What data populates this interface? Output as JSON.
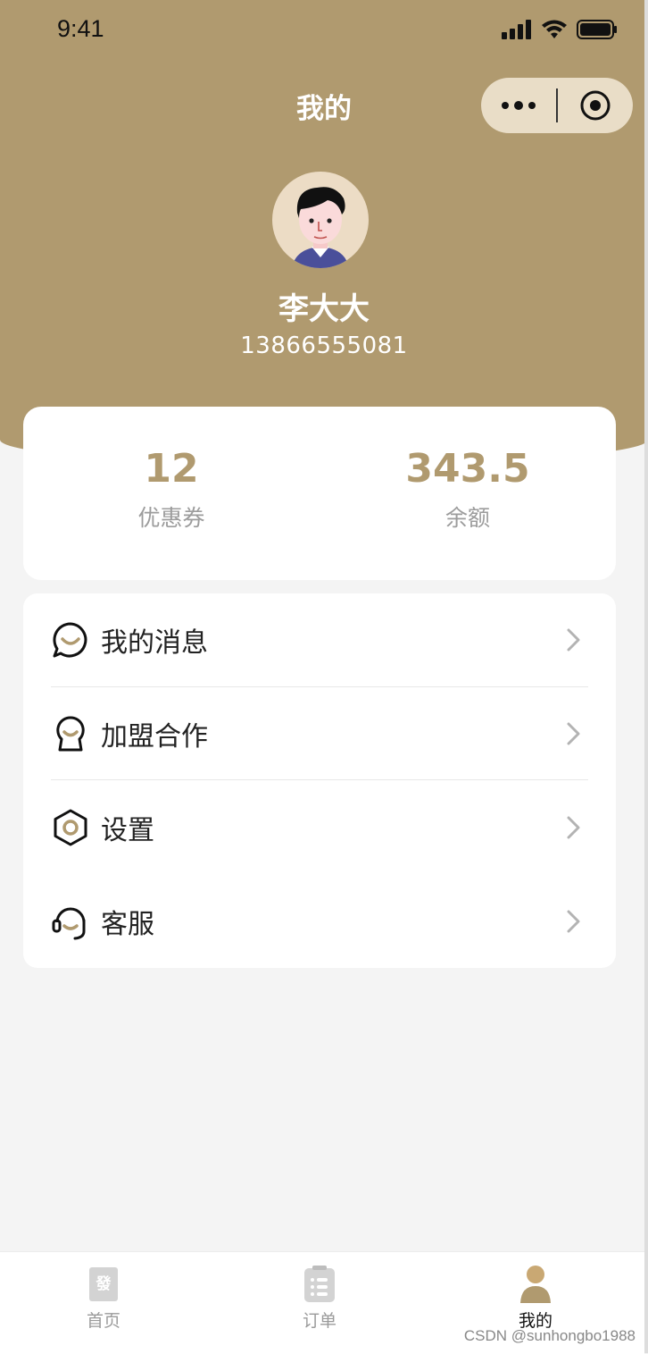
{
  "status_bar": {
    "time": "9:41"
  },
  "nav": {
    "title": "我的"
  },
  "profile": {
    "name": "李大大",
    "phone": "13866555081"
  },
  "stats": [
    {
      "value": "12",
      "label": "优惠券"
    },
    {
      "value": "343.5",
      "label": "余额"
    }
  ],
  "menu": {
    "items": [
      {
        "label": "我的消息",
        "icon": "chat-bubble-icon"
      },
      {
        "label": "加盟合作",
        "icon": "handshake-person-icon"
      },
      {
        "label": "设置",
        "icon": "hex-gear-icon"
      },
      {
        "label": "客服",
        "icon": "headset-icon"
      }
    ]
  },
  "tabbar": {
    "tabs": [
      {
        "label": "首页",
        "icon_text": "發",
        "active": false
      },
      {
        "label": "订单",
        "active": false
      },
      {
        "label": "我的",
        "active": true
      }
    ]
  },
  "watermark": "CSDN @sunhongbo1988",
  "colors": {
    "brand": "#b09a6f",
    "capsule": "#e9ddc7",
    "background": "#f4f4f4"
  }
}
